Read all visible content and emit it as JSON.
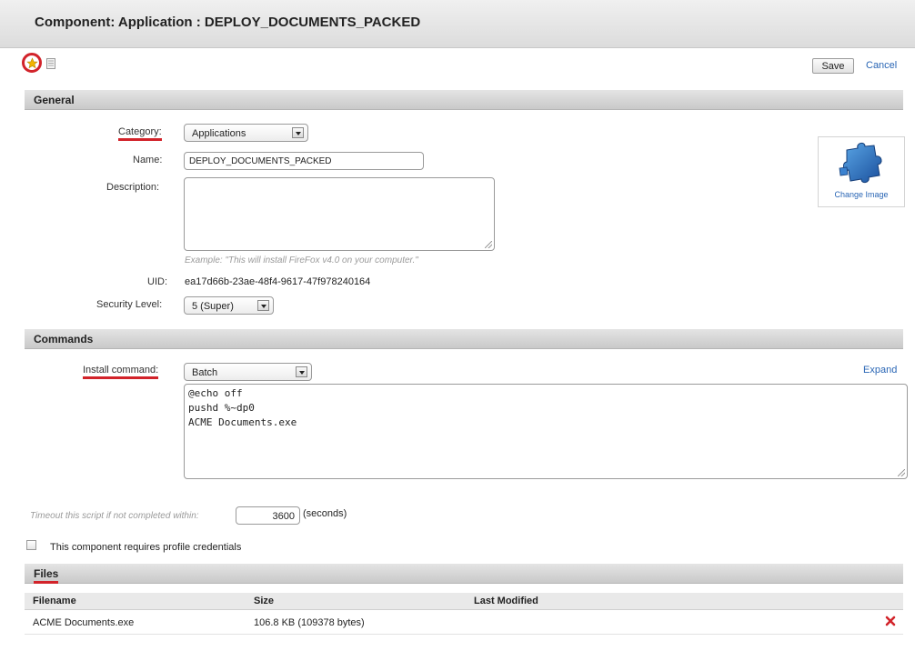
{
  "window": {
    "title": "Component: Application : DEPLOY_DOCUMENTS_PACKED"
  },
  "toolbar": {
    "save_label": "Save",
    "cancel_label": "Cancel"
  },
  "general": {
    "section_label": "General",
    "category_label": "Category:",
    "category_value": "Applications",
    "name_label": "Name:",
    "name_value": "DEPLOY_DOCUMENTS_PACKED",
    "description_label": "Description:",
    "description_value": "",
    "description_hint": "Example: \"This will install FireFox v4.0 on your computer.\"",
    "uid_label": "UID:",
    "uid_value": "ea17d66b-23ae-48f4-9617-47f978240164",
    "security_label": "Security Level:",
    "security_value": "5 (Super)",
    "change_image_label": "Change Image"
  },
  "commands": {
    "section_label": "Commands",
    "install_label": "Install command:",
    "install_type": "Batch",
    "expand_label": "Expand",
    "script_lines": [
      "@echo off",
      "pushd %~dp0",
      "ACME Documents.exe"
    ],
    "timeout_label": "Timeout this script if not completed within:",
    "timeout_value": "3600",
    "timeout_unit": "(seconds)",
    "credentials_label": "This component requires profile credentials"
  },
  "files": {
    "section_label": "Files",
    "columns": [
      "Filename",
      "Size",
      "Last Modified"
    ],
    "rows": [
      {
        "filename": "ACME Documents.exe",
        "size": "106.8 KB (109378 bytes)",
        "modified": ""
      }
    ]
  },
  "colors": {
    "accent_red": "#d2232a",
    "link_blue": "#2a66b5",
    "star_yellow": "#f2b600"
  },
  "icons": [
    "star-icon",
    "document-icon",
    "puzzle-piece-icon",
    "dropdown-arrow-icon",
    "delete-icon"
  ]
}
